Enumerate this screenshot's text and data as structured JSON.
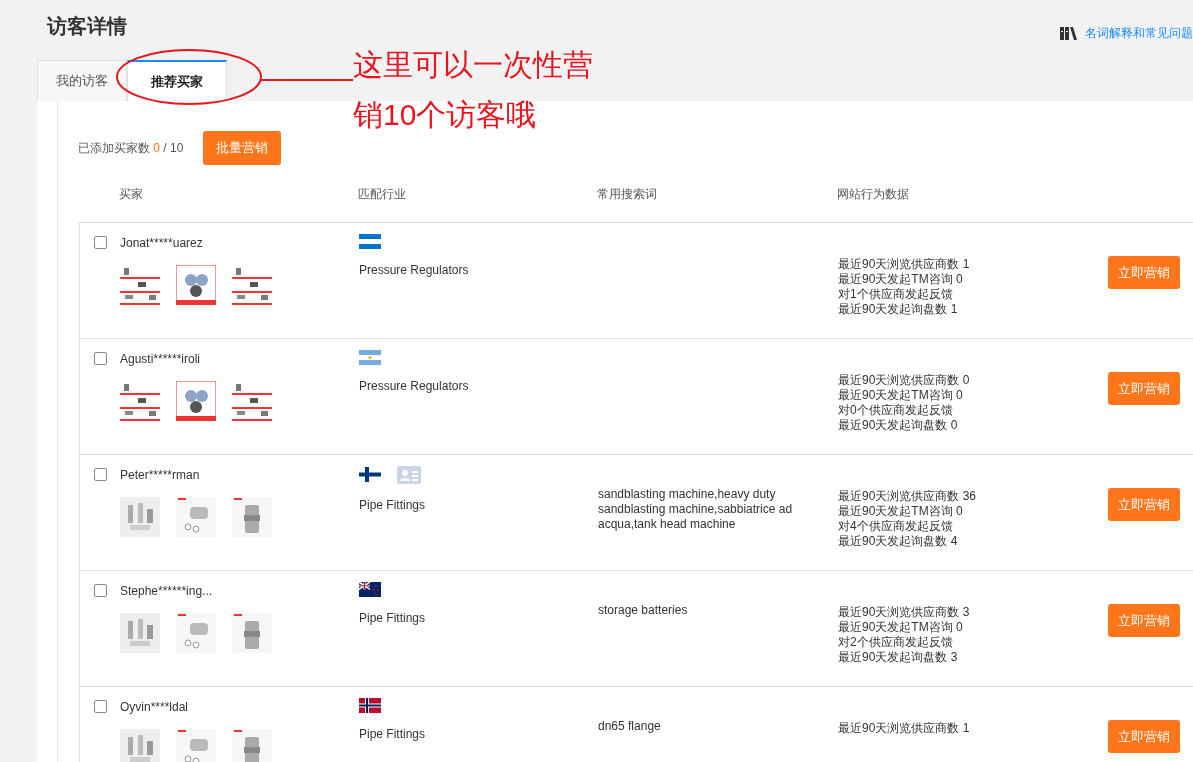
{
  "page_title": "访客详情",
  "help_link": "名词解释和常见问题",
  "tabs": [
    {
      "label": "我的访客",
      "selected": false
    },
    {
      "label": "推荐买家",
      "selected": true
    }
  ],
  "toolbar": {
    "added_label": "已添加买家数",
    "added_count": "0",
    "added_limit": "/ 10",
    "bulk_button": "批量营销"
  },
  "columns": [
    "买家",
    "匹配行业",
    "常用搜索词",
    "网站行为数据"
  ],
  "buyers": [
    {
      "checked": false,
      "name": "Jonat*****uarez",
      "card": false,
      "thumbnails": [
        {
          "kind": "picture"
        },
        {
          "kind": "picture"
        },
        {
          "kind": "picture"
        }
      ],
      "industry": "Pressure Regulators",
      "stats": [
        "最近90天浏览供应商数 1",
        "最近90天发起TM咨询 0",
        "对1个供应商发起反馈",
        "最近90天发起询盘数 1"
      ],
      "button": "立即营销"
    },
    {
      "checked": false,
      "name": "Agusti******iroli",
      "card": false,
      "thumbnails": [
        {
          "kind": "picture"
        },
        {
          "kind": "picture"
        },
        {
          "kind": "picture"
        }
      ],
      "industry": "Pressure Regulators",
      "stats": [
        "最近90天浏览供应商数 0",
        "最近90天发起TM咨询 0",
        "对0个供应商发起反馈",
        "最近90天发起询盘数 0"
      ],
      "button": "立即营销"
    },
    {
      "checked": false,
      "name": "Peter*****rman",
      "card": true,
      "thumbnails": [
        {
          "kind": "picture"
        },
        {
          "kind": "picture"
        },
        {
          "kind": "picture"
        }
      ],
      "industry": "Pipe Fittings",
      "search_terms": "sandblasting machine,heavy duty sandblasting machine,sabbiatrice ad acqua,tank head machine",
      "stats": [
        "最近90天浏览供应商数 36",
        "最近90天发起TM咨询 0",
        "对4个供应商发起反馈",
        "最近90天发起询盘数 4"
      ],
      "button": "立即营销"
    },
    {
      "checked": false,
      "name": "Stephe******ing...",
      "card": false,
      "thumbnails": [
        {
          "kind": "picture"
        },
        {
          "kind": "picture"
        },
        {
          "kind": "picture"
        }
      ],
      "industry": "Pipe Fittings",
      "search_terms": "storage batteries",
      "stats": [
        "最近90天浏览供应商数 3",
        "最近90天发起TM咨询 0",
        "对2个供应商发起反馈",
        "最近90天发起询盘数 3"
      ],
      "button": "立即营销"
    },
    {
      "checked": false,
      "name": "Oyvin****ldal",
      "card": false,
      "thumbnails": [
        {
          "kind": "picture"
        },
        {
          "kind": "picture"
        },
        {
          "kind": "picture"
        }
      ],
      "industry": "Pipe Fittings",
      "search_terms": "dn65 flange",
      "stats": [
        "最近90天浏览供应商数 1"
      ],
      "button": "立即营销"
    }
  ],
  "annotation": "这里可以一次性营销10个访客哦"
}
